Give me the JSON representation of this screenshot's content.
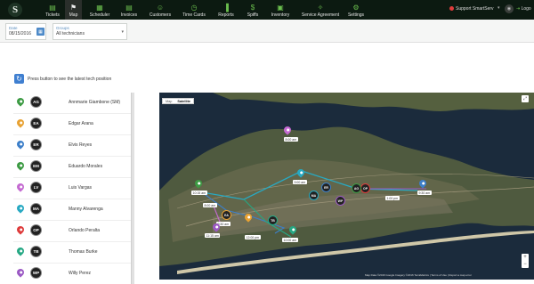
{
  "nav": {
    "logo_letter": "S",
    "items": [
      {
        "label": "Tickets",
        "icon": "ticket-icon",
        "glyph": "▤"
      },
      {
        "label": "Map",
        "icon": "map-pin-icon",
        "glyph": "⚑"
      },
      {
        "label": "Scheduler",
        "icon": "calendar-icon",
        "glyph": "▦"
      },
      {
        "label": "Invoices",
        "icon": "invoice-icon",
        "glyph": "▤"
      },
      {
        "label": "Customers",
        "icon": "customers-icon",
        "glyph": "☺"
      },
      {
        "label": "Time Cards",
        "icon": "clock-icon",
        "glyph": "◷"
      },
      {
        "label": "Reports",
        "icon": "bar-chart-icon",
        "glyph": "▐"
      },
      {
        "label": "Spiffs",
        "icon": "money-icon",
        "glyph": "$"
      },
      {
        "label": "Inventory",
        "icon": "inventory-icon",
        "glyph": "▣"
      },
      {
        "label": "Service Agreement",
        "icon": "handshake-icon",
        "glyph": "✧"
      },
      {
        "label": "Settings",
        "icon": "gear-icon",
        "glyph": "⚙"
      }
    ],
    "support": "Support SmartServ",
    "logout": "Logo",
    "accent": "#6bbf4e"
  },
  "filters": {
    "date_label": "Date",
    "date_value": "08/15/2016",
    "group_label": "Groups",
    "group_value": "All technicians"
  },
  "refresh_text": "Press button to see the latest tech position",
  "techs": [
    {
      "name": "Annmarie Giambone (SM)",
      "initials": "AG",
      "color": "#3d9b44"
    },
    {
      "name": "Edgar Arana",
      "initials": "EA",
      "color": "#e8a233"
    },
    {
      "name": "Elvis Reyes",
      "initials": "ER",
      "color": "#3d7fc9"
    },
    {
      "name": "Eduardo Morales",
      "initials": "EM",
      "color": "#3d9b44"
    },
    {
      "name": "Luis Vargas",
      "initials": "LV",
      "color": "#c46ad1"
    },
    {
      "name": "Manny Alvarenga",
      "initials": "MA",
      "color": "#28a9c2"
    },
    {
      "name": "Orlando Peralta",
      "initials": "OP",
      "color": "#de3b3b"
    },
    {
      "name": "Thomas Burke",
      "initials": "TB",
      "color": "#26a884"
    },
    {
      "name": "Willy Perez",
      "initials": "WP",
      "color": "#9b59c4"
    }
  ],
  "map": {
    "toggle_map": "Map",
    "toggle_satellite": "Satellite",
    "attribution": "Map Data ©2016 Google Imagery ©2016 TerraMetrics | Terms of Use | Report a map error",
    "labels": [
      "8:00 am",
      "9:00 am",
      "10:15 am",
      "8:00 am",
      "9:30 am",
      "11:15 am",
      "12:00 pm",
      "10:00 am",
      "9:30 am",
      "1:00 pm"
    ],
    "avatars": [
      "MA",
      "ER",
      "WP",
      "OP",
      "AG",
      "TB",
      "EA"
    ]
  }
}
